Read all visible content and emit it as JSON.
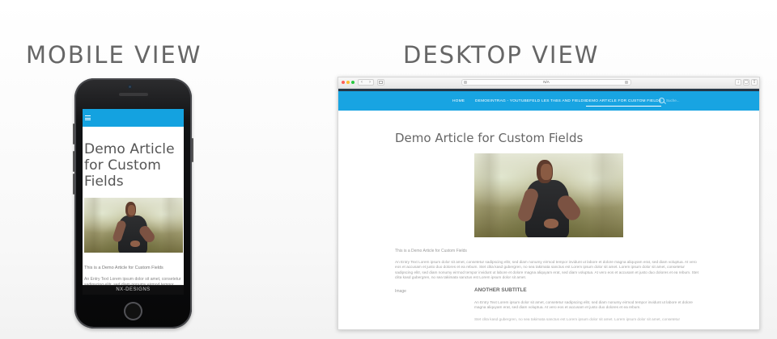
{
  "headings": {
    "mobile": "MOBILE VIEW",
    "desktop": "DESKTOP VIEW"
  },
  "mobile": {
    "title": "Demo Article for Custom Fields",
    "intro": "This is a Demo Article for Custom Fields",
    "body": "An Entry Text Lorem ipsum dolor sit amet, consetetur sadipscing elitr, sed diam nonumy eirmod tempor invidunt ut labore et dolore magna aliquyam erat, sed diam voluptua. At vero eos et accusam et justo duo",
    "footer": "NX-DESIGNS"
  },
  "desktop": {
    "browser": {
      "address": "N/A"
    },
    "nav": {
      "items": [
        "HOME",
        "DEMOEINTRAG - YOUTUBEFELD",
        "LES TABS AND FIELDS",
        "DEMO ARTICLE FOR CUSTOM FIELDS"
      ],
      "search_placeholder": "Suche..."
    },
    "title": "Demo Article for Custom Fields",
    "intro": "This is a Demo Article for Custom Fields",
    "body": "An Entry Text Lorem ipsum dolor sit amet, consetetur sadipscing elitr, sed diam nonumy eirmod tempor invidunt ut labore et dolore magna aliquyam erat, sed diam voluptua. At vero eos et accusam et justo duo dolores et ea rebum. Stet clita kasd gubergren, no sea takimata sanctus est Lorem ipsum dolor sit amet. Lorem ipsum dolor sit amet, consetetur sadipscing elitr, sed diam nonumy eirmod tempor invidunt ut labore et dolore magna aliquyam erat, sed diam voluptua. At vero eos et accusam et justo duo dolores et ea rebum. Stet clita kasd gubergren, no sea takimata sanctus est Lorem ipsum dolor sit amet.",
    "field_label": "Image",
    "subtitle": "ANOTHER SUBTITLE",
    "subtitle_body": "An Entry Text Lorem ipsum dolor sit amet, consetetur sadipscing elitr, sed diam nonumy eirmod tempor invidunt ut labore et dolore magna aliquyam erat, sed diam voluptua. At vero eos et accusam et justo duo dolores et ea rebum.",
    "cutoff_line": "Stet clita kasd gubergren, no sea takimata sanctus est Lorem ipsum dolor sit amet. Lorem ipsum dolor sit amet, consetetur"
  },
  "colors": {
    "brand_blue": "#18a4e2",
    "dark_strip": "#253646"
  },
  "icons": [
    "hamburger-icon",
    "search-icon",
    "home-button",
    "traffic-light-icons"
  ]
}
